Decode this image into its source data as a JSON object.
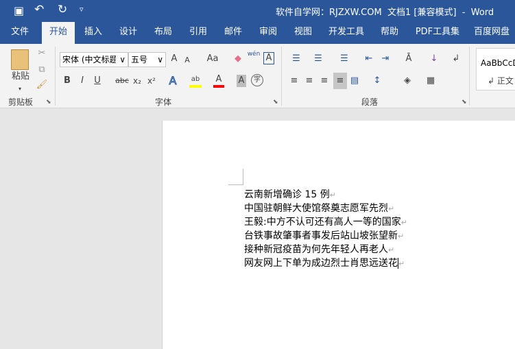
{
  "title": "软件自学网：RJZXW.COM  文档1 [兼容模式]  -  Word",
  "quick_access": {
    "save": "save-icon",
    "undo": "undo-icon",
    "redo": "redo-icon",
    "customize": "▿"
  },
  "tabs": [
    "文件",
    "开始",
    "插入",
    "设计",
    "布局",
    "引用",
    "邮件",
    "审阅",
    "视图",
    "开发工具",
    "帮助",
    "PDF工具集",
    "百度网盘"
  ],
  "ribbon": {
    "clipboard": {
      "label": "剪贴板",
      "paste": "粘贴"
    },
    "font": {
      "label": "字体",
      "font_name": "宋体 (中文标题",
      "font_size": "五号",
      "change_case": "Aa",
      "phonetic": "wén",
      "bold": "B",
      "italic": "I",
      "underline": "U",
      "strike": "abc",
      "sub": "x₂",
      "sup": "x²",
      "text_effects": "A",
      "highlight": "ab",
      "font_color": "A",
      "shading": "A",
      "enclose": "字",
      "grow": "A",
      "shrink": "A",
      "border_char": "A"
    },
    "paragraph": {
      "label": "段落"
    },
    "styles": {
      "preview": "AaBbCcD",
      "normal": "↲ 正文"
    }
  },
  "document": {
    "lines": [
      "云南新增确诊 15 例",
      "中国驻朝鲜大使馆祭奠志愿军先烈",
      "王毅:中方不认可还有高人一等的国家",
      "台铁事故肇事者事发后站山坡张望新",
      "接种新冠疫苗为何先年轻人再老人",
      "网友网上下单为成边烈士肖思远送花"
    ],
    "paragraph_mark": "↵"
  },
  "colors": {
    "brand": "#2b579a",
    "highlight": "#ffff00",
    "font_color": "#ff0000"
  }
}
